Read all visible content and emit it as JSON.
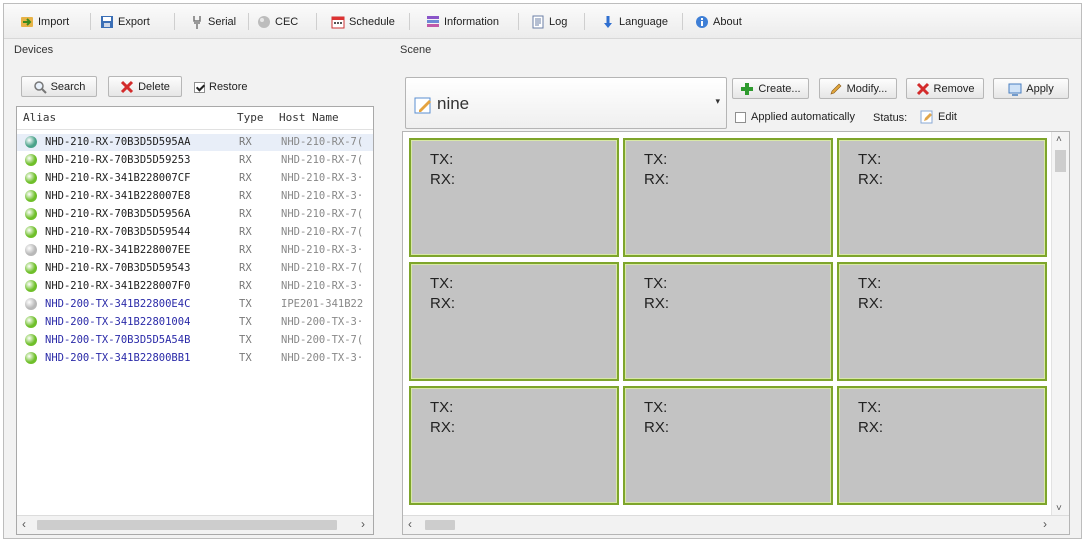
{
  "toolbar": {
    "import": "Import",
    "export": "Export",
    "serial": "Serial",
    "cec": "CEC",
    "schedule": "Schedule",
    "information": "Information",
    "log": "Log",
    "language": "Language",
    "about": "About"
  },
  "devices": {
    "title": "Devices",
    "search": "Search",
    "delete": "Delete",
    "restore": "Restore",
    "restore_checked": true,
    "columns": {
      "alias": "Alias",
      "type": "Type",
      "host": "Host Name"
    },
    "rows": [
      {
        "alias": "NHD-210-RX-70B3D5D595AA",
        "type": "RX",
        "host": "NHD-210-RX-7(",
        "status": "teal"
      },
      {
        "alias": "NHD-210-RX-70B3D5D59253",
        "type": "RX",
        "host": "NHD-210-RX-7(",
        "status": "green"
      },
      {
        "alias": "NHD-210-RX-341B228007CF",
        "type": "RX",
        "host": "NHD-210-RX-3·",
        "status": "green"
      },
      {
        "alias": "NHD-210-RX-341B228007E8",
        "type": "RX",
        "host": "NHD-210-RX-3·",
        "status": "green"
      },
      {
        "alias": "NHD-210-RX-70B3D5D5956A",
        "type": "RX",
        "host": "NHD-210-RX-7(",
        "status": "green"
      },
      {
        "alias": "NHD-210-RX-70B3D5D59544",
        "type": "RX",
        "host": "NHD-210-RX-7(",
        "status": "green"
      },
      {
        "alias": "NHD-210-RX-341B228007EE",
        "type": "RX",
        "host": "NHD-210-RX-3·",
        "status": "grey"
      },
      {
        "alias": "NHD-210-RX-70B3D5D59543",
        "type": "RX",
        "host": "NHD-210-RX-7(",
        "status": "green"
      },
      {
        "alias": "NHD-210-RX-341B228007F0",
        "type": "RX",
        "host": "NHD-210-RX-3·",
        "status": "green"
      },
      {
        "alias": "NHD-200-TX-341B22800E4C",
        "type": "TX",
        "host": "IPE201-341B22",
        "status": "grey"
      },
      {
        "alias": "NHD-200-TX-341B22801004",
        "type": "TX",
        "host": "NHD-200-TX-3·",
        "status": "green"
      },
      {
        "alias": "NHD-200-TX-70B3D5D5A54B",
        "type": "TX",
        "host": "NHD-200-TX-7(",
        "status": "green"
      },
      {
        "alias": "NHD-200-TX-341B22800BB1",
        "type": "TX",
        "host": "NHD-200-TX-3·",
        "status": "green"
      }
    ]
  },
  "scene": {
    "title": "Scene",
    "selected": "nine",
    "create": "Create...",
    "modify": "Modify...",
    "remove": "Remove",
    "apply": "Apply",
    "applied_auto": "Applied automatically",
    "applied_auto_checked": false,
    "status_label": "Status:",
    "edit": "Edit",
    "tiles": [
      {
        "tx": "TX:",
        "rx": "RX:"
      },
      {
        "tx": "TX:",
        "rx": "RX:"
      },
      {
        "tx": "TX:",
        "rx": "RX:"
      },
      {
        "tx": "TX:",
        "rx": "RX:"
      },
      {
        "tx": "TX:",
        "rx": "RX:"
      },
      {
        "tx": "TX:",
        "rx": "RX:"
      },
      {
        "tx": "TX:",
        "rx": "RX:"
      },
      {
        "tx": "TX:",
        "rx": "RX:"
      },
      {
        "tx": "TX:",
        "rx": "RX:"
      }
    ]
  },
  "colors": {
    "status_green": "#6fbf2a",
    "status_teal": "#4aa38a",
    "status_grey": "#b8b8b8",
    "rx_text": "#1d1d1d",
    "tx_text": "#2a2aa8",
    "tile_border": "#7ea52b"
  }
}
